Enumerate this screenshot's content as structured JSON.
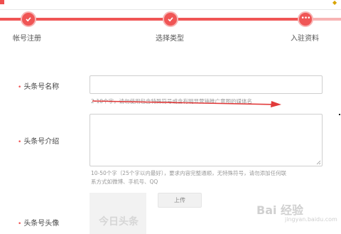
{
  "steps": [
    {
      "label": "帐号注册",
      "state": "done"
    },
    {
      "label": "选择类型",
      "state": "done"
    },
    {
      "label": "入驻资料",
      "state": "current"
    }
  ],
  "form": {
    "name_label": "头条号名称",
    "name_value": "",
    "name_hint": "2-10个字，请勿使用包含特殊符号或含有明显营销推广意图的媒体名",
    "intro_label": "头条号介绍",
    "intro_value": "",
    "intro_hint_line1": "10-50个字（25个字以内最好），要求内容完整通顺，无特殊符号，请勿添加任何联",
    "intro_hint_line2": "系方式如微博、手机号、QQ",
    "avatar_label": "头条号头像",
    "avatar_placeholder_text": "今日头条",
    "upload_label": "上传"
  },
  "watermark": {
    "text": "Bai 经验",
    "sub": "jingyan.baidu.com"
  },
  "colors": {
    "accent": "#f05555",
    "arrow": "#e23b3b"
  }
}
